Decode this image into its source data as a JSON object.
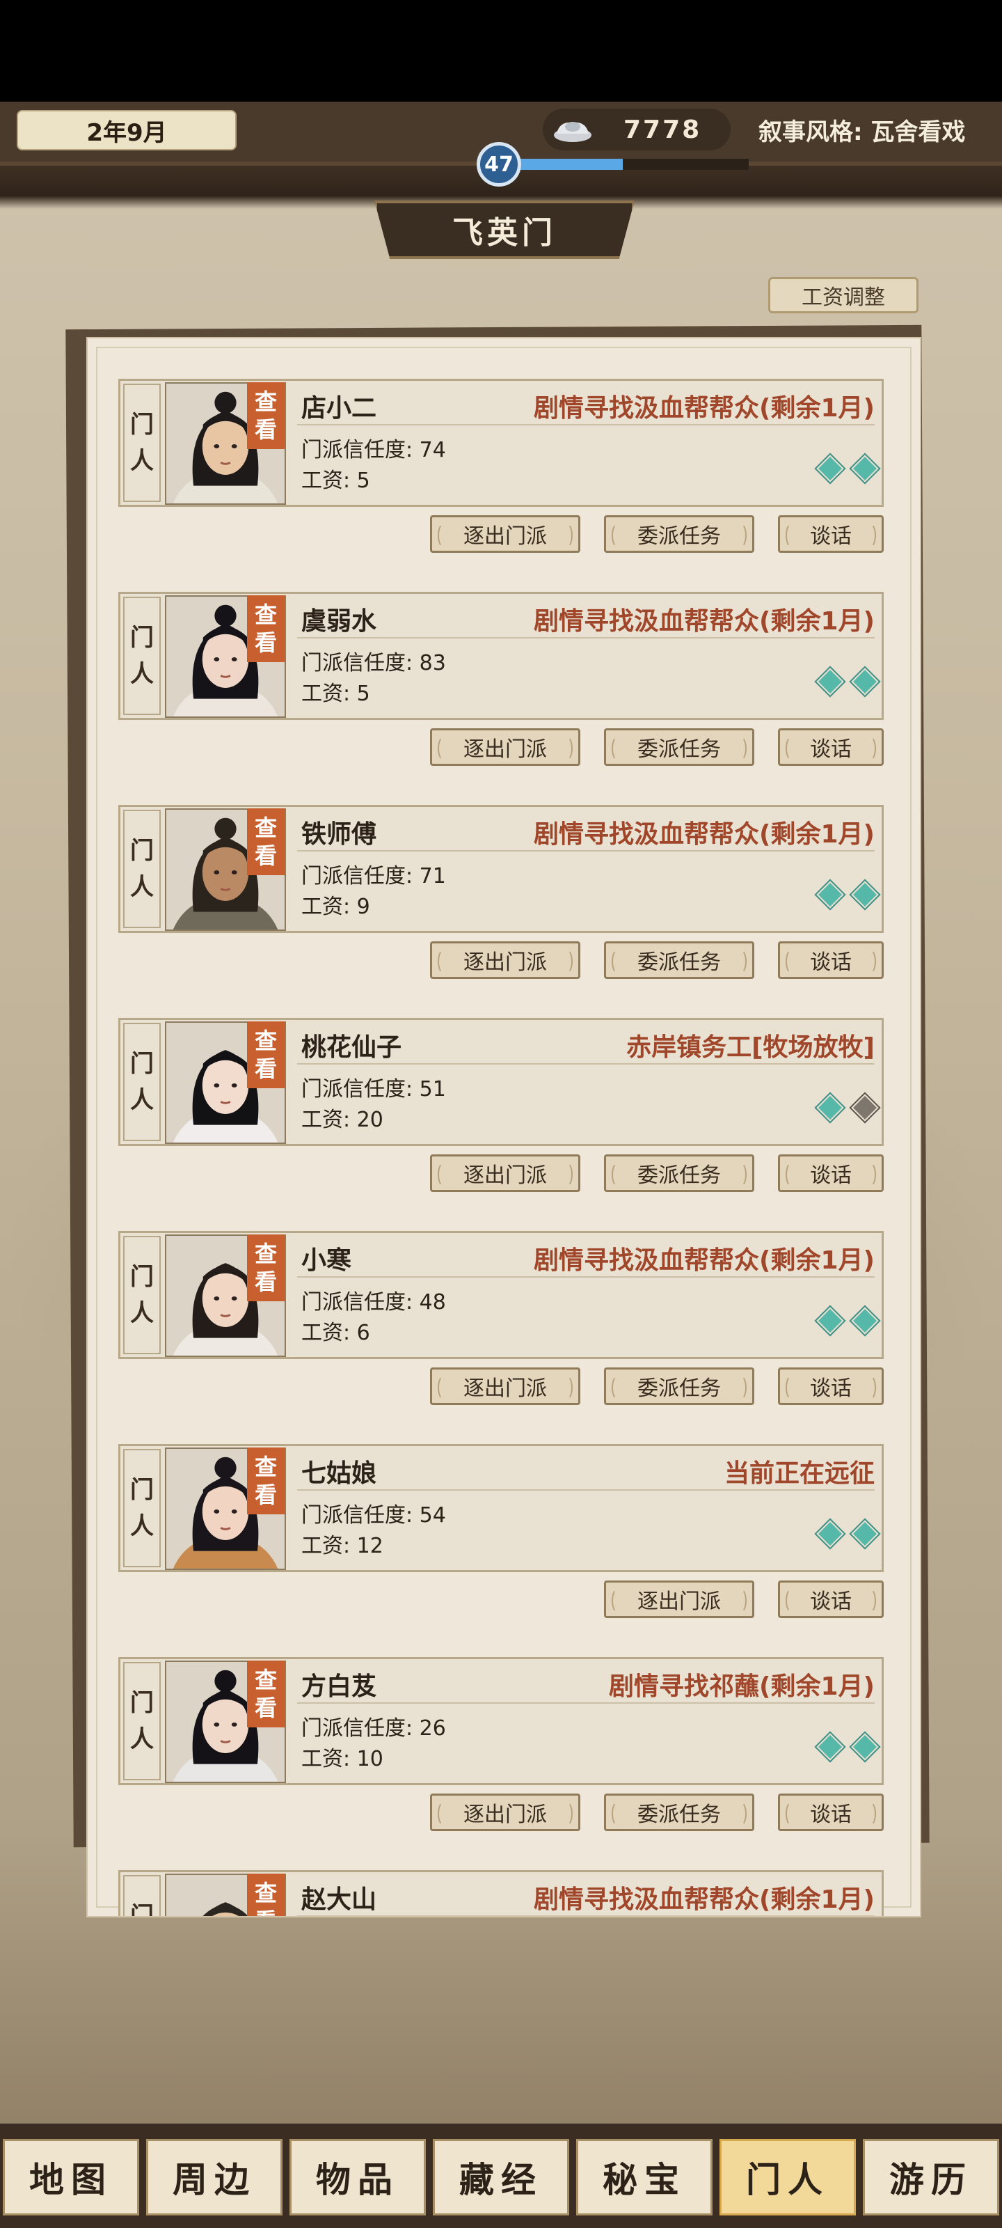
{
  "header": {
    "date": "2年9月",
    "silver": "7778",
    "narrative_style": "叙事风格: 瓦舍看戏",
    "level": "47",
    "xp_fraction": 0.45,
    "sect_name": "飞英门",
    "wage_adjust_label": "工资调整"
  },
  "labels": {
    "tag_top": "门",
    "tag_bottom": "人",
    "view_top": "查",
    "view_bottom": "看",
    "trust_prefix": "门派信任度: ",
    "wage_prefix": "工资: ",
    "expel": "逐出门派",
    "assign": "委派任务",
    "talk": "谈话"
  },
  "members": [
    {
      "name": "店小二",
      "status": "剧情寻找汲血帮帮众(剩余1月)",
      "trust": "74",
      "wage": "5",
      "gems": [
        "on",
        "on"
      ],
      "actions": [
        "expel",
        "assign",
        "talk"
      ],
      "portrait": "male-scholar"
    },
    {
      "name": "虞弱水",
      "status": "剧情寻找汲血帮帮众(剩余1月)",
      "trust": "83",
      "wage": "5",
      "gems": [
        "on",
        "on"
      ],
      "actions": [
        "expel",
        "assign",
        "talk"
      ],
      "portrait": "female-a"
    },
    {
      "name": "铁师傅",
      "status": "剧情寻找汲血帮帮众(剩余1月)",
      "trust": "71",
      "wage": "9",
      "gems": [
        "on",
        "on"
      ],
      "actions": [
        "expel",
        "assign",
        "talk"
      ],
      "portrait": "male-smith"
    },
    {
      "name": "桃花仙子",
      "status": "赤岸镇务工[牧场放牧]",
      "trust": "51",
      "wage": "20",
      "gems": [
        "on",
        "off"
      ],
      "actions": [
        "expel",
        "assign",
        "talk"
      ],
      "portrait": "female-b"
    },
    {
      "name": "小寒",
      "status": "剧情寻找汲血帮帮众(剩余1月)",
      "trust": "48",
      "wage": "6",
      "gems": [
        "on",
        "on"
      ],
      "actions": [
        "expel",
        "assign",
        "talk"
      ],
      "portrait": "female-c"
    },
    {
      "name": "七姑娘",
      "status": "当前正在远征",
      "trust": "54",
      "wage": "12",
      "gems": [
        "on",
        "on"
      ],
      "actions": [
        "expel",
        "talk"
      ],
      "portrait": "female-d"
    },
    {
      "name": "方白芨",
      "status": "剧情寻找祁蘸(剩余1月)",
      "trust": "26",
      "wage": "10",
      "gems": [
        "on",
        "on"
      ],
      "actions": [
        "expel",
        "assign",
        "talk"
      ],
      "portrait": "female-e"
    },
    {
      "name": "赵大山",
      "status": "剧情寻找汲血帮帮众(剩余1月)",
      "trust": "",
      "wage": "",
      "gems": [],
      "actions": [],
      "portrait": "male-plain"
    }
  ],
  "nav": [
    {
      "label": "地图",
      "active": false
    },
    {
      "label": "周边",
      "active": false
    },
    {
      "label": "物品",
      "active": false
    },
    {
      "label": "藏经",
      "active": false
    },
    {
      "label": "秘宝",
      "active": false
    },
    {
      "label": "门人",
      "active": true
    },
    {
      "label": "游历",
      "active": false
    }
  ],
  "colors": {
    "accent": "#c85f2f",
    "status_red": "#a0472b",
    "gem_teal": "#56b8a8",
    "xp_blue": "#5aa8e6"
  }
}
